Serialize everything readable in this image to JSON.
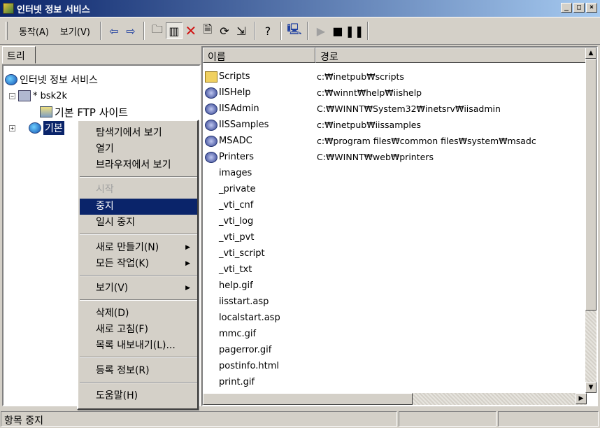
{
  "window": {
    "title": "인터넷 정보 서비스"
  },
  "toolbar": {
    "action_menu": "동작(A)",
    "view_menu": "보기(V)"
  },
  "tree": {
    "tab_label": "트리",
    "root": "인터넷 정보 서비스",
    "server": "* bsk2k",
    "ftp_site": "기본 FTP 사이트",
    "web_site_partial": "기본"
  },
  "list": {
    "col_name": "이름",
    "col_path": "경로",
    "items": [
      {
        "name": "Scripts",
        "path": "c:₩inetpub₩scripts"
      },
      {
        "name": "IISHelp",
        "path": "c:₩winnt₩help₩iishelp"
      },
      {
        "name": "IISAdmin",
        "path": "C:₩WINNT₩System32₩inetsrv₩iisadmin"
      },
      {
        "name": "IISSamples",
        "path": "c:₩inetpub₩iissamples"
      },
      {
        "name": "MSADC",
        "path": "c:₩program files₩common files₩system₩msadc"
      },
      {
        "name": "Printers",
        "path": "C:₩WINNT₩web₩printers"
      },
      {
        "name": "images",
        "path": ""
      },
      {
        "name": "_private",
        "path": ""
      },
      {
        "name": "_vti_cnf",
        "path": ""
      },
      {
        "name": "_vti_log",
        "path": ""
      },
      {
        "name": "_vti_pvt",
        "path": ""
      },
      {
        "name": "_vti_script",
        "path": ""
      },
      {
        "name": "_vti_txt",
        "path": ""
      },
      {
        "name": "help.gif",
        "path": ""
      },
      {
        "name": "iisstart.asp",
        "path": ""
      },
      {
        "name": "localstart.asp",
        "path": ""
      },
      {
        "name": "mmc.gif",
        "path": ""
      },
      {
        "name": "pagerror.gif",
        "path": ""
      },
      {
        "name": "postinfo.html",
        "path": ""
      },
      {
        "name": "print.gif",
        "path": ""
      }
    ]
  },
  "context_menu": {
    "explore": "탐색기에서 보기",
    "open": "열기",
    "browse": "브라우저에서 보기",
    "start": "시작",
    "stop": "중지",
    "pause": "일시 중지",
    "new": "새로 만들기(N)",
    "all_tasks": "모든 작업(K)",
    "view": "보기(V)",
    "delete": "삭제(D)",
    "refresh": "새로 고침(F)",
    "export": "목록 내보내기(L)...",
    "properties": "등록 정보(R)",
    "help": "도움말(H)"
  },
  "status": {
    "text": "항목 중지"
  }
}
